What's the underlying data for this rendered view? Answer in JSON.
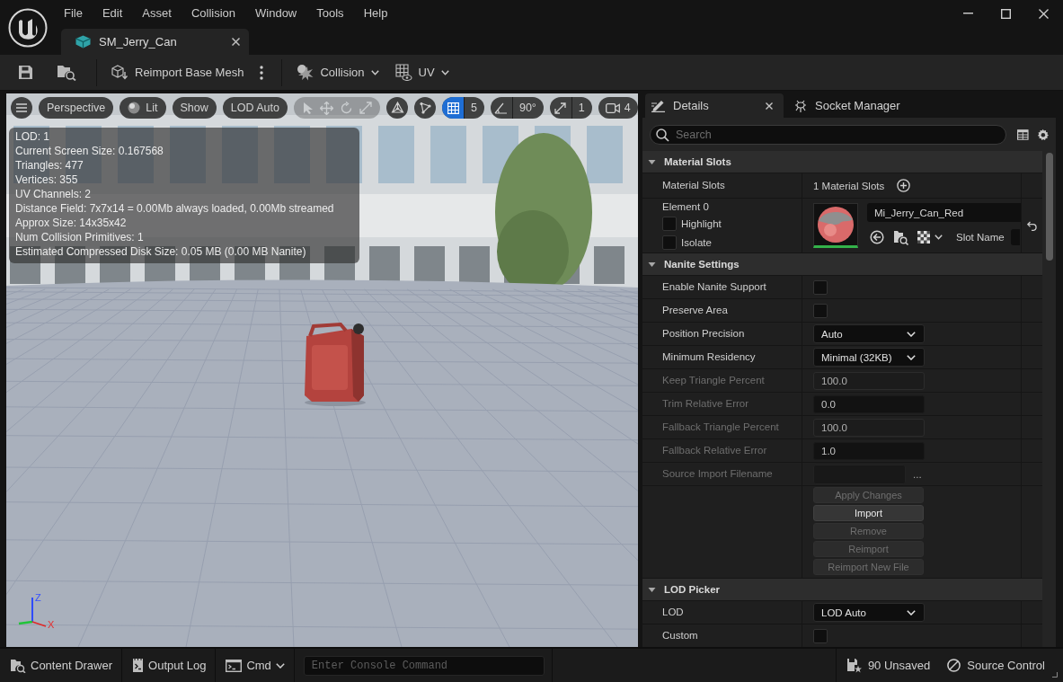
{
  "window": {
    "menu": [
      "File",
      "Edit",
      "Asset",
      "Collision",
      "Window",
      "Tools",
      "Help"
    ]
  },
  "document_tabs": [
    {
      "label": "SM_Jerry_Can",
      "selected": true
    }
  ],
  "toolbar": {
    "reimport": "Reimport Base Mesh",
    "menus": [
      {
        "kind": "collision",
        "label": "Collision"
      },
      {
        "kind": "uv",
        "label": "UV"
      }
    ]
  },
  "viewport": {
    "buttons": [
      {
        "kind": "text",
        "label": "Perspective"
      },
      {
        "kind": "lit",
        "label": "Lit"
      },
      {
        "kind": "text",
        "label": "Show"
      },
      {
        "kind": "text",
        "label": "LOD Auto"
      }
    ],
    "transform_tools": {
      "disabled": true
    },
    "snaps": [
      {
        "kind": "grid",
        "value": "5",
        "on": true
      },
      {
        "kind": "angle",
        "value": "90°",
        "on": false
      },
      {
        "kind": "scale",
        "value": "1",
        "on": false
      }
    ],
    "camera_speed": "4",
    "stats": [
      "LOD: 1",
      "Current Screen Size: 0.167568",
      "Triangles: 477",
      "Vertices: 355",
      "UV Channels: 2",
      "Distance Field: 7x7x14 = 0.00Mb always loaded, 0.00Mb streamed",
      "Approx Size: 14x35x42",
      "Num Collision Primitives: 1",
      "Estimated Compressed Disk Size: 0.05 MB (0.00 MB Nanite)"
    ],
    "axes": [
      {
        "kind": "z",
        "label": "Z"
      },
      {
        "kind": "x",
        "label": "X"
      }
    ]
  },
  "details": {
    "tabs": [
      {
        "kind": "details",
        "label": "Details",
        "selected": true
      },
      {
        "kind": "sockets",
        "label": "Socket Manager",
        "selected": false
      }
    ],
    "search": {
      "placeholder": "Search"
    },
    "sections": [
      {
        "title": "Material Slots",
        "expanded": true,
        "rows": [
          {
            "kind": "count",
            "label": "Material Slots",
            "value": "1 Material Slots"
          },
          {
            "kind": "material",
            "label": "Element 0",
            "options": [
              {
                "label": "Highlight",
                "checked": false
              },
              {
                "label": "Isolate",
                "checked": false
              }
            ],
            "value": "Mi_Jerry_Can_Red",
            "slot_label": "Slot Name",
            "reset": true
          }
        ]
      },
      {
        "title": "Nanite Settings",
        "expanded": true,
        "rows": [
          {
            "kind": "checkbox",
            "label": "Enable Nanite Support",
            "checked": false,
            "disabled": false
          },
          {
            "kind": "checkbox",
            "label": "Preserve Area",
            "checked": false,
            "disabled": false
          },
          {
            "kind": "dropdown",
            "label": "Position Precision",
            "value": "Auto",
            "disabled": false
          },
          {
            "kind": "dropdown",
            "label": "Minimum Residency",
            "value": "Minimal (32KB)",
            "disabled": false
          },
          {
            "kind": "number",
            "label": "Keep Triangle Percent",
            "value": "100.0",
            "disabled": true,
            "editable": false
          },
          {
            "kind": "number",
            "label": "Trim Relative Error",
            "value": "0.0",
            "disabled": true,
            "editable": true
          },
          {
            "kind": "number",
            "label": "Fallback Triangle Percent",
            "value": "100.0",
            "disabled": true,
            "editable": false
          },
          {
            "kind": "number",
            "label": "Fallback Relative Error",
            "value": "1.0",
            "disabled": true,
            "editable": true
          },
          {
            "kind": "file",
            "label": "Source Import Filename",
            "disabled": true,
            "browse": "..."
          },
          {
            "kind": "buttons",
            "buttons": [
              {
                "label": "Apply Changes",
                "disabled": true
              },
              {
                "label": "Import",
                "disabled": false
              },
              {
                "label": "Remove",
                "disabled": true
              },
              {
                "label": "Reimport",
                "disabled": true
              },
              {
                "label": "Reimport New File",
                "disabled": true
              }
            ]
          }
        ]
      },
      {
        "title": "LOD Picker",
        "expanded": true,
        "rows": [
          {
            "kind": "dropdown",
            "label": "LOD",
            "value": "LOD Auto",
            "disabled": false
          },
          {
            "kind": "checkbox",
            "label": "Custom",
            "checked": false,
            "disabled": false
          }
        ]
      }
    ]
  },
  "status_bar": {
    "items": [
      {
        "kind": "content_drawer",
        "label": "Content Drawer"
      },
      {
        "kind": "output_log",
        "label": "Output Log"
      },
      {
        "kind": "cmd",
        "label": "Cmd"
      }
    ],
    "console": {
      "placeholder": "Enter Console Command"
    },
    "unsaved": "90 Unsaved",
    "source_control": "Source Control"
  }
}
